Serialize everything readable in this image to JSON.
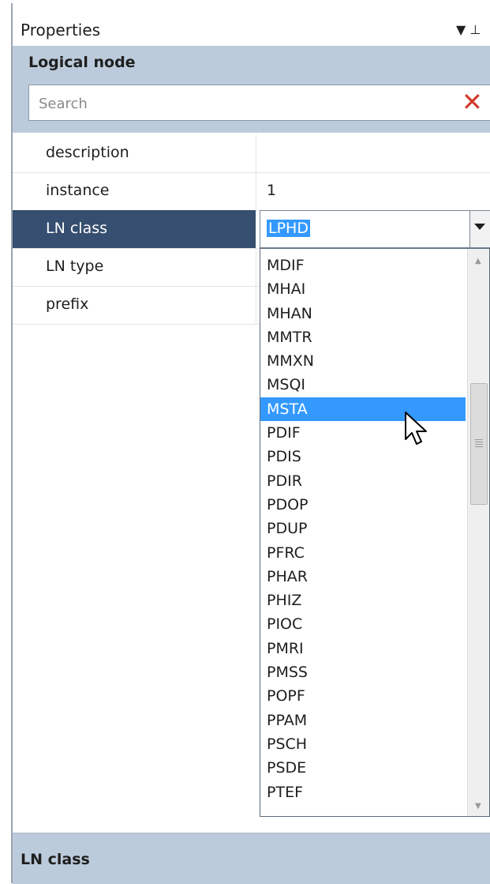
{
  "panel": {
    "title": "Properties",
    "pin_glyph": "▼  ⊥"
  },
  "category": {
    "title": "Logical node"
  },
  "search": {
    "placeholder": "Search",
    "value": "",
    "clear_icon": "close-icon"
  },
  "properties": [
    {
      "name": "description",
      "value": ""
    },
    {
      "name": "instance",
      "value": "1"
    },
    {
      "name": "LN class",
      "value": "LPHD",
      "selected": true
    },
    {
      "name": "LN type",
      "value": ""
    },
    {
      "name": "prefix",
      "value": ""
    }
  ],
  "combo": {
    "value": "LPHD"
  },
  "dropdown": {
    "options": [
      "MDIF",
      "MHAI",
      "MHAN",
      "MMTR",
      "MMXN",
      "MSQI",
      "MSTA",
      "PDIF",
      "PDIS",
      "PDIR",
      "PDOP",
      "PDUP",
      "PFRC",
      "PHAR",
      "PHIZ",
      "PIOC",
      "PMRI",
      "PMSS",
      "POPF",
      "PPAM",
      "PSCH",
      "PSDE",
      "PTEF"
    ],
    "highlighted": "MSTA"
  },
  "description_panel": {
    "title": "LN class"
  },
  "colors": {
    "selection": "#3399ff",
    "selected_row": "#364e6f",
    "category_band": "#bccbdb",
    "clear_icon": "#d33a2c"
  }
}
